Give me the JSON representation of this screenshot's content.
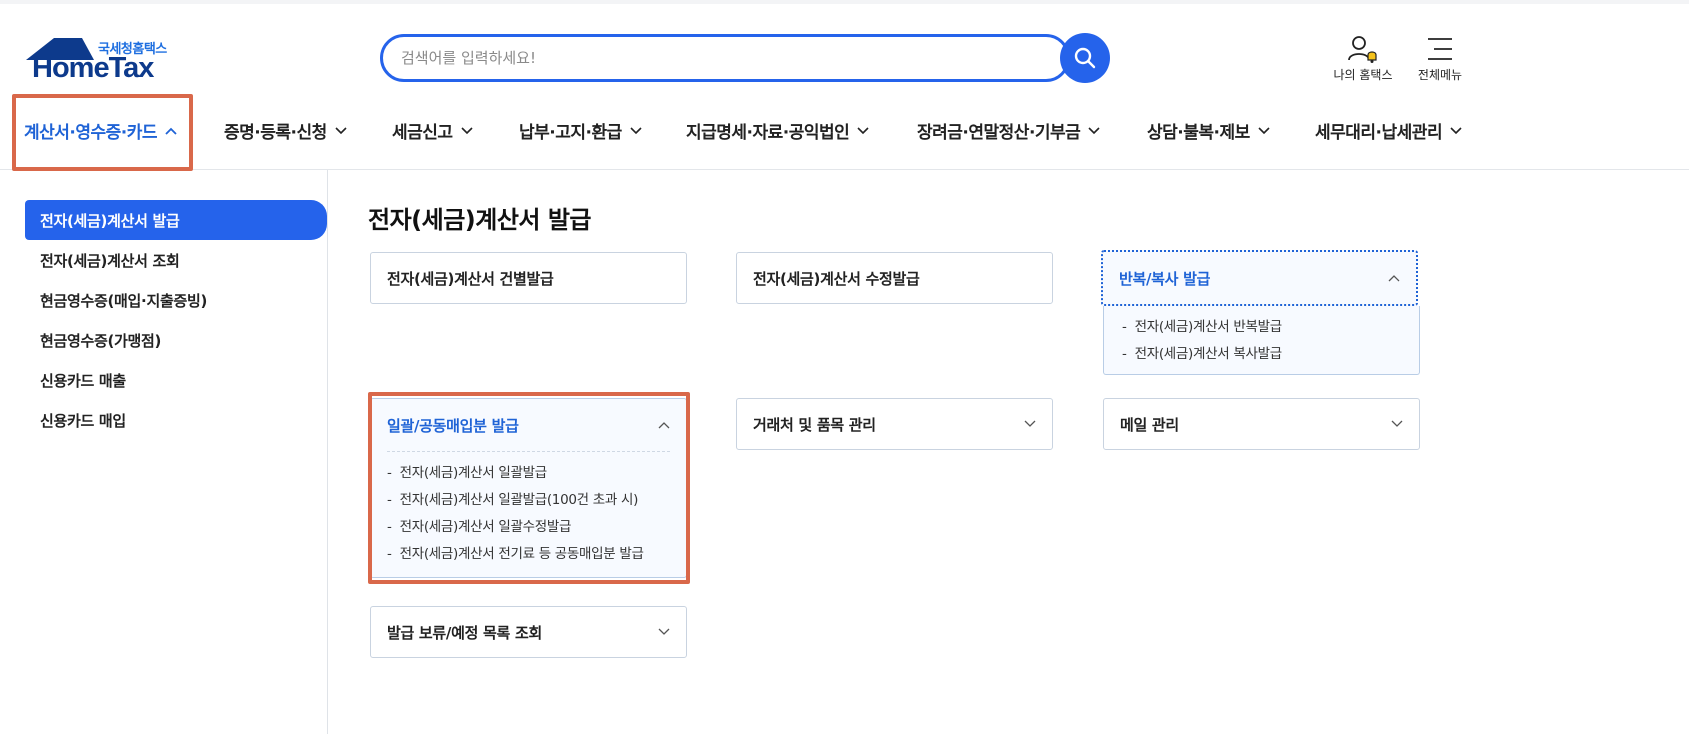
{
  "brand": {
    "sub": "국세청홈택스",
    "name": "HomeTax",
    "color": "#0d3a8c"
  },
  "search": {
    "placeholder": "검색어를 입력하세요!"
  },
  "utils": {
    "my": "나의 홈택스",
    "menu": "전체메뉴"
  },
  "gnb": [
    {
      "label": "계산서·영수증·카드",
      "active": true
    },
    {
      "label": "증명·등록·신청"
    },
    {
      "label": "세금신고"
    },
    {
      "label": "납부·고지·환급"
    },
    {
      "label": "지급명세·자료·공익법인"
    },
    {
      "label": "장려금·연말정산·기부금"
    },
    {
      "label": "상담·불복·제보"
    },
    {
      "label": "세무대리·납세관리"
    }
  ],
  "sidebar": {
    "items": [
      {
        "label": "전자(세금)계산서 발급",
        "active": true
      },
      {
        "label": "전자(세금)계산서 조회"
      },
      {
        "label": "현금영수증(매입·지출증빙)"
      },
      {
        "label": "현금영수증(가맹점)"
      },
      {
        "label": "신용카드 매출"
      },
      {
        "label": "신용카드 매입"
      }
    ]
  },
  "main": {
    "title": "전자(세금)계산서 발급",
    "cards": {
      "single": "전자(세금)계산서 건별발급",
      "modify": "전자(세금)계산서 수정발급",
      "repeat": {
        "label": "반복/복사 발급",
        "items": [
          "전자(세금)계산서 반복발급",
          "전자(세금)계산서 복사발급"
        ]
      },
      "bulk": {
        "label": "일괄/공동매입분 발급",
        "items": [
          "전자(세금)계산서 일괄발급",
          "전자(세금)계산서 일괄발급(100건 초과 시)",
          "전자(세금)계산서 일괄수정발급",
          "전자(세금)계산서 전기료 등 공동매입분 발급"
        ]
      },
      "partner": "거래처 및 품목 관리",
      "mail": "메일 관리",
      "pending": "발급 보류/예정 목록 조회"
    }
  },
  "colors": {
    "accent": "#2563eb",
    "highlight": "#d9684a"
  }
}
